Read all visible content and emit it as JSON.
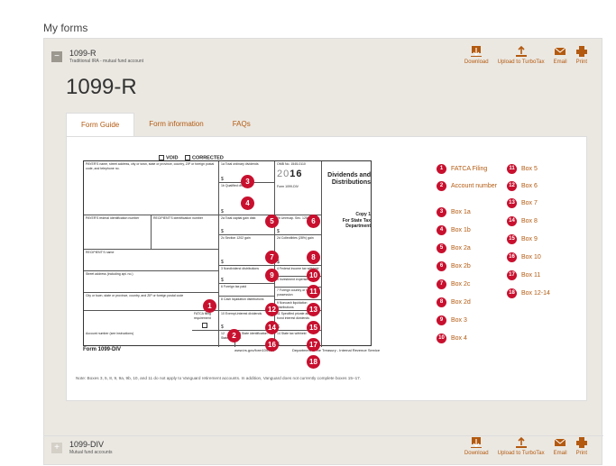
{
  "page": {
    "title": "My forms"
  },
  "account1": {
    "title": "1099-R",
    "subtitle": "Traditional IRA - mutual fund account",
    "collapse_icon": "minus-icon"
  },
  "actions": {
    "download": "Download",
    "upload": "Upload to TurboTax",
    "email": "Email",
    "print": "Print"
  },
  "form_title": "1099-R",
  "tabs": [
    "Form Guide",
    "Form information",
    "FAQs"
  ],
  "form": {
    "void": "VOID",
    "corrected": "CORRECTED",
    "payer_name": "PAYER'S name, street address, city or town, state or province, country, ZIP or foreign postal code, and telephone no.",
    "box1a": "1a  Total ordinary dividends",
    "box1b": "1b  Qualified dividends",
    "omb": "OMB No. 1545-0110",
    "year_prefix": "20",
    "year_suffix": "16",
    "form_name": "Form 1099-DIV",
    "title": "Dividends and Distributions",
    "box2a": "2a  Total capital gain distr.",
    "box2b": "2b  Unrecap. Sec. 1250 gain",
    "payer_id": "PAYER'S federal identification number",
    "recipient_id": "RECIPIENT'S identification number",
    "box2c": "2c  Section 1202 gain",
    "box2d": "2d  Collectibles (28%) gain",
    "copy": "Copy 1",
    "copy_for": "For State Tax Department",
    "recipient_name": "RECIPIENT'S name",
    "box3": "3  Nondividend distributions",
    "box4": "4  Federal income tax withheld",
    "box5": "5  Investment expenses",
    "street": "Street address (including apt. no.)",
    "box6": "6  Foreign tax paid",
    "box7": "7  Foreign country or U.S. possession",
    "city": "City or town, state or province, country, and ZIP or foreign postal code",
    "box8": "8  Cash liquidation distributions",
    "box9": "9  Noncash liquidation distributions",
    "fatca": "FATCA filing requirement",
    "box10": "10  Exempt-interest dividends",
    "box11": "11  Specified private activity bond interest dividends",
    "account": "Account number (see instructions)",
    "box12": "12  State",
    "box13": "13  State identification no.",
    "box14": "14  State tax withheld",
    "dollar": "$",
    "footer_form": "Form 1099-DIV",
    "footer_url": "www.irs.gov/form1099div",
    "footer_dept": "Department of the Treasury - Internal Revenue Service"
  },
  "legend": [
    {
      "num": "1",
      "label": "FATCA Filing"
    },
    {
      "num": "2",
      "label": "Account number"
    },
    {
      "num": "3",
      "label": "Box 1a"
    },
    {
      "num": "4",
      "label": "Box 1b"
    },
    {
      "num": "5",
      "label": "Box 2a"
    },
    {
      "num": "6",
      "label": "Box 2b"
    },
    {
      "num": "7",
      "label": "Box 2c"
    },
    {
      "num": "8",
      "label": "Box 2d"
    },
    {
      "num": "9",
      "label": "Box 3"
    },
    {
      "num": "10",
      "label": "Box 4"
    },
    {
      "num": "11",
      "label": "Box 5"
    },
    {
      "num": "12",
      "label": "Box 6"
    },
    {
      "num": "13",
      "label": "Box 7"
    },
    {
      "num": "14",
      "label": "Box 8"
    },
    {
      "num": "15",
      "label": "Box 9"
    },
    {
      "num": "16",
      "label": "Box 10"
    },
    {
      "num": "17",
      "label": "Box 11"
    },
    {
      "num": "18",
      "label": "Box 12-14"
    }
  ],
  "note": "Note: Boxes 3, 5, 8, 9, 9a, 9b, 10, and 11 do not apply to Vanguard retirement accounts. In addition, Vanguard does not currently complete boxes 15–17.",
  "account2": {
    "title": "1099-DIV",
    "subtitle": "Mutual fund accounts",
    "expand_icon": "plus-icon"
  },
  "colors": {
    "accent": "#b35a10",
    "badge": "#c8102e",
    "panel": "#ebe8e2"
  }
}
